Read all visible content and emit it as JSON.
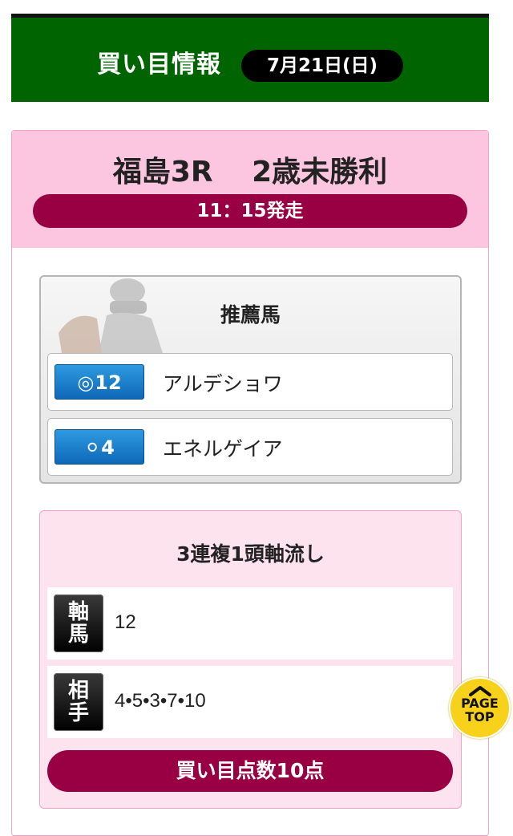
{
  "header": {
    "title": "買い目情報",
    "date": "7月21日(日)"
  },
  "race": {
    "title": "福島3R　 2歳未勝利",
    "start_time": "11：15発走"
  },
  "recommended": {
    "title": "推薦馬",
    "horses": [
      {
        "mark": "◎",
        "number": "12",
        "name": "アルデショワ"
      },
      {
        "mark": "⚪",
        "number": "4",
        "name": "エネルゲイア"
      }
    ],
    "mark_color": "#1a7fd0"
  },
  "bet": {
    "title": "3連複1頭軸流し",
    "rows": [
      {
        "role": [
          "軸",
          "馬"
        ],
        "value": "12"
      },
      {
        "role": [
          "相",
          "手"
        ],
        "value": "4•5•3•7•10"
      }
    ],
    "count": "買い目点数10点"
  },
  "page_top": {
    "line1": "PAGE",
    "line2": "TOP"
  },
  "colors": {
    "header_bg": "#006400",
    "accent": "#990044",
    "pink": "#fcc6e0"
  }
}
